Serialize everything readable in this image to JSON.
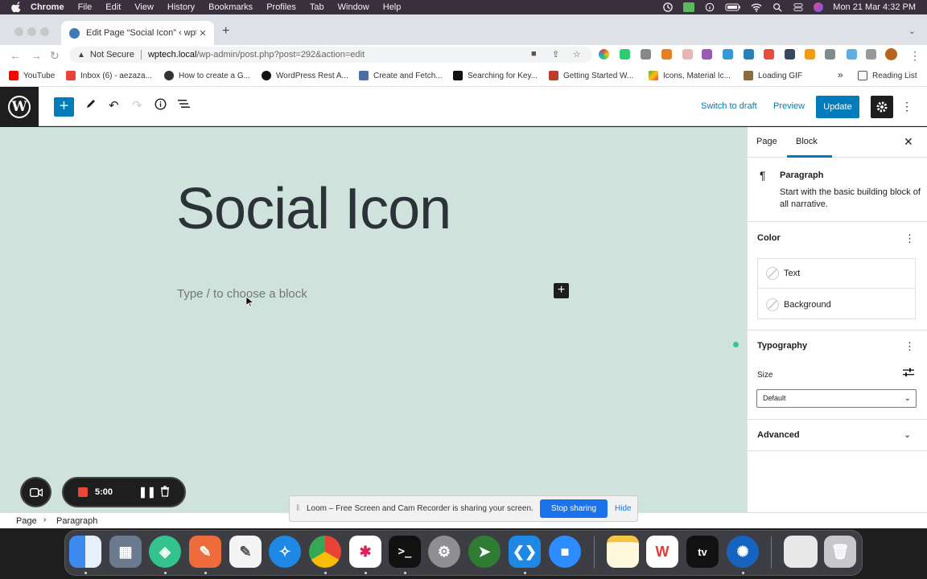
{
  "menubar": {
    "app": "Chrome",
    "items": [
      "File",
      "Edit",
      "View",
      "History",
      "Bookmarks",
      "Profiles",
      "Tab",
      "Window",
      "Help"
    ],
    "datetime": "Mon 21 Mar  4:32 PM"
  },
  "browser": {
    "tab_title": "Edit Page “Social Icon” ‹ wptec",
    "security_label": "Not Secure",
    "url_host": "wptech.local",
    "url_path": "/wp-admin/post.php?post=292&action=edit",
    "bookmarks": [
      {
        "label": "YouTube",
        "color": "#ff0000"
      },
      {
        "label": "Inbox (6) - aezaza...",
        "color": "#ea4335"
      },
      {
        "label": "How to create a G...",
        "color": "#333333"
      },
      {
        "label": "WordPress Rest A...",
        "color": "#111111"
      },
      {
        "label": "Create and Fetch...",
        "color": "#4a6fa5"
      },
      {
        "label": "Searching for Key...",
        "color": "#111111"
      },
      {
        "label": "Getting Started W...",
        "color": "#c0392b"
      },
      {
        "label": "Icons, Material Ic...",
        "color": "#4caf50"
      },
      {
        "label": "Loading GIF",
        "color": "#8a6d3b"
      }
    ],
    "bookmarks_overflow": "»",
    "reading_list": "Reading List"
  },
  "editor": {
    "switch_to_draft": "Switch to draft",
    "preview": "Preview",
    "update": "Update",
    "page_title": "Social Icon",
    "block_placeholder": "Type / to choose a block"
  },
  "sidebar": {
    "tabs": [
      "Page",
      "Block"
    ],
    "active_tab": "Block",
    "block_name": "Paragraph",
    "block_description": "Start with the basic building block of all narrative.",
    "color_heading": "Color",
    "color_options": [
      "Text",
      "Background"
    ],
    "typography_heading": "Typography",
    "size_label": "Size",
    "size_value": "Default",
    "advanced_heading": "Advanced"
  },
  "breadcrumb": {
    "items": [
      "Page",
      "Paragraph"
    ]
  },
  "loom": {
    "timer": "5:00",
    "banner_text": "Loom – Free Screen and Cam Recorder is sharing your screen.",
    "stop_label": "Stop sharing",
    "hide_label": "Hide"
  },
  "colors": {
    "wp_blue": "#007cba",
    "canvas_bg": "#cfe3dc",
    "loom_red": "#e8483b"
  }
}
